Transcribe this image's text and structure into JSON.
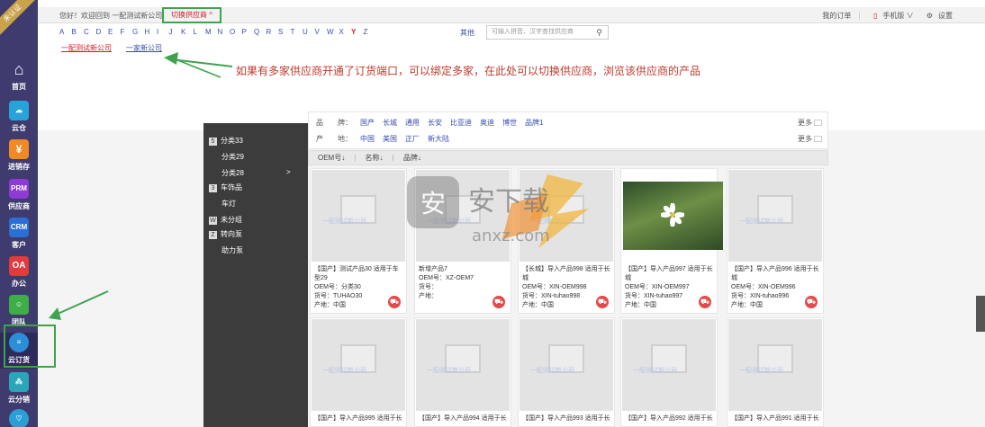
{
  "sidebar": {
    "ribbon": "未认证",
    "items": [
      {
        "label": "首页",
        "icon": "home-icon",
        "color": "#3f3b6e"
      },
      {
        "label": "云仓",
        "icon": "cloud-icon",
        "color": "#28a3d9"
      },
      {
        "label": "进销存",
        "icon": "yen-icon",
        "color": "#f08a24"
      },
      {
        "label": "供应商",
        "icon": "PRM",
        "color": "#8e3ad6"
      },
      {
        "label": "客户",
        "icon": "CRM",
        "color": "#2a6fd6"
      },
      {
        "label": "办公",
        "icon": "OA",
        "color": "#e23b3b"
      },
      {
        "label": "团队",
        "icon": "team-icon",
        "color": "#3fae49"
      },
      {
        "label": "云订货",
        "icon": "chat-icon",
        "color": "#2a8fd6"
      },
      {
        "label": "云分销",
        "icon": "share-icon",
        "color": "#2aa6b8"
      },
      {
        "label": "",
        "icon": "heart-icon",
        "color": "#2a9fd6"
      }
    ]
  },
  "topbar": {
    "greeting": "您好！欢迎回到 一配测试新公司",
    "switch_supplier": "切换供应商 ^",
    "my_orders": "我的订单",
    "mobile": "手机版 ∨",
    "settings": "设置"
  },
  "letters": [
    "A",
    "B",
    "C",
    "D",
    "E",
    "F",
    "G",
    "H",
    "I",
    "J",
    "K",
    "L",
    "M",
    "N",
    "O",
    "P",
    "Q",
    "R",
    "S",
    "T",
    "U",
    "V",
    "W",
    "X",
    "Y",
    "Z"
  ],
  "letters_other": "其他",
  "supplier_search_placeholder": "可输入拼音、汉字查找供应商",
  "suppliers": [
    "一配测试新公司",
    "一家新公司"
  ],
  "annotation": "如果有多家供应商开通了订货端口，可以绑定多家，在此处可以切换供应商，浏览该供应商的产品",
  "categories": [
    {
      "box": "5",
      "label": "分类33"
    },
    {
      "box": "",
      "label": "分类29"
    },
    {
      "box": "",
      "label": "分类28"
    },
    {
      "box": "3",
      "label": "车饰品"
    },
    {
      "box": "",
      "label": "车灯"
    },
    {
      "box": "W",
      "label": "未分组"
    },
    {
      "box": "Z",
      "label": "转向泵"
    },
    {
      "box": "",
      "label": "助力泵"
    }
  ],
  "filters": {
    "brand_label": "品　　牌：",
    "brands": [
      "国产",
      "长城",
      "通用",
      "长安",
      "比亚迪",
      "奥迪",
      "博世",
      "品牌1"
    ],
    "origin_label": "产　　地：",
    "origins": [
      "中国",
      "美国",
      "正厂",
      "新大陆"
    ],
    "more": "更多"
  },
  "sort": [
    "OEM号↓",
    "名称↓",
    "品牌↓"
  ],
  "placeholder_company": "一配测试新公司",
  "products_row1": [
    {
      "title": "【国产】测试产品30 适用于车型29",
      "oem": "OEM号：分类30",
      "code": "货号：TUHAO30",
      "origin": "产地：中国"
    },
    {
      "title": "新增产品7",
      "oem": "OEM号：XZ-OEM7",
      "code": "货号：",
      "origin": "产地："
    },
    {
      "title": "【长城】导入产品998 适用于长城",
      "oem": "OEM号：XIN-OEM998",
      "code": "货号：XIN-tuhao998",
      "origin": "产地：中国"
    },
    {
      "title": "【国产】导入产品997 适用于长城",
      "oem": "OEM号：XIN-OEM997",
      "code": "货号：XIN-tuhao997",
      "origin": "产地：中国"
    },
    {
      "title": "【国产】导入产品996 适用于长城",
      "oem": "OEM号：XIN-OEM996",
      "code": "货号：XIN-tuhao996",
      "origin": "产地：中国"
    }
  ],
  "products_row2": [
    {
      "title": "【国产】导入产品995 适用于长"
    },
    {
      "title": "【国产】导入产品994 适用于长"
    },
    {
      "title": "【国产】导入产品993 适用于长"
    },
    {
      "title": "【国产】导入产品992 适用于长"
    },
    {
      "title": "【国产】导入产品991 适用于长"
    }
  ],
  "watermark": {
    "glyph": "安",
    "name": "安下载",
    "url": "anxz.com"
  }
}
